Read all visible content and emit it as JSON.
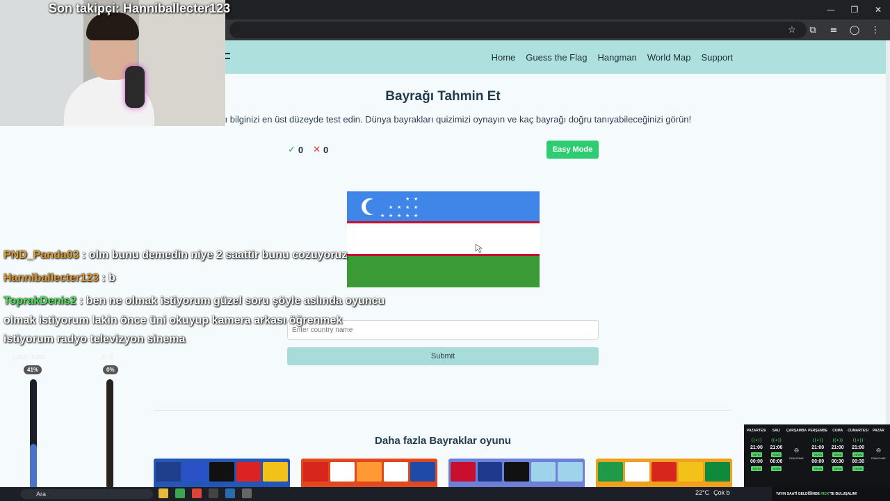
{
  "window": {
    "controls": [
      "—",
      "❐",
      "✕"
    ],
    "toolbar_icons": [
      "☆",
      "⧉",
      "≡",
      "◯",
      "⋮"
    ]
  },
  "nav": {
    "links": [
      "Home",
      "Guess the Flag",
      "Hangman",
      "World Map",
      "Support"
    ]
  },
  "main": {
    "title": "Bayrağı Tahmin Et",
    "subtitle": "arı bilginizi en üst düzeyde test edin. Dünya bayrakları quizimizi oynayın ve kaç bayrağı doğru tanıyabileceğinizi görün!",
    "score": {
      "correct": "0",
      "wrong": "0"
    },
    "mode_button": "Easy Mode",
    "input_placeholder": "Enter country name",
    "submit_label": "Submit",
    "more_title": "Daha fazla Bayraklar oyunu"
  },
  "overlay": {
    "last_follower": "Son takipçi: Hanniballecter123",
    "chat": [
      {
        "user": "PND_Panda03",
        "sep": " : ",
        "msg": "olm bunu demedin niye 2 saattir bunu cozuyoruz"
      },
      {
        "user": "Hanniballecter123",
        "sep": " : ",
        "msg": "b"
      },
      {
        "user": "ToprakDenis2",
        "sep": " : ",
        "msg": "ben ne olmak istiyorum güzel soru şöyle aslında oyuncu"
      }
    ],
    "chat_wrap": [
      "olmak istiyorum lakin önce üni okuyup kamera arkası öğrenmek",
      "istiyorum radyo televizyon sinema"
    ],
    "bars": [
      {
        "label": "1.653 / 4.000",
        "pill": "41%",
        "level": 0.41
      },
      {
        "label": "0 / 5",
        "pill": "0%",
        "level": 0.0
      }
    ],
    "schedule": [
      {
        "day": "PAZARTESI",
        "on": true,
        "t1": "21:00",
        "t2": "00:00",
        "tag": "YAYIN"
      },
      {
        "day": "SALI",
        "on": true,
        "t1": "21:00",
        "t2": "00:00",
        "tag": "YAYIN"
      },
      {
        "day": "ÇARŞAMBA",
        "on": false,
        "off": "DİNLENME"
      },
      {
        "day": "PERŞEMBE",
        "on": true,
        "t1": "21:00",
        "t2": "00:00",
        "tag": "YAYIN"
      },
      {
        "day": "CUMA",
        "on": true,
        "t1": "21:00",
        "t2": "00:30",
        "tag": "YAYIN"
      },
      {
        "day": "CUMARTESI",
        "on": true,
        "t1": "21:00",
        "t2": "00:30",
        "tag": "YAYIN"
      },
      {
        "day": "PAZAR",
        "on": false,
        "off": "DİNLENME"
      }
    ],
    "ticker_pre": "YAYIN SAATİ GELDİĞİNDE ",
    "ticker_brand": "KICK",
    "ticker_post": "'TE BULUŞALIM!"
  },
  "taskbar": {
    "search": "Ara",
    "weather": "22°C",
    "weather_desc": "Çok b"
  },
  "colors": {
    "accent": "#aee0dd",
    "success": "#2ecc71",
    "flag_blue": "#3f86e8",
    "flag_green": "#3a9a36",
    "flag_red": "#c8102e"
  }
}
